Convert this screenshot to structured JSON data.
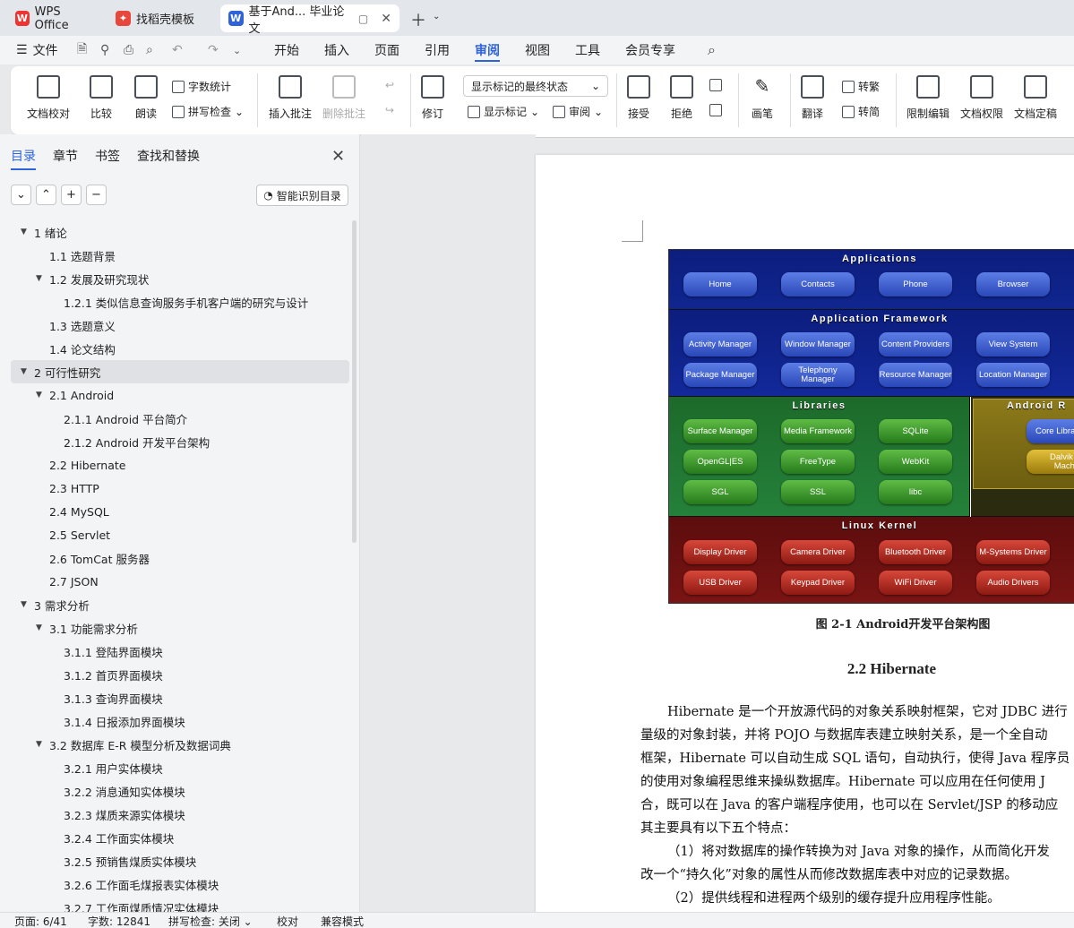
{
  "tabs": [
    {
      "label": "WPS Office"
    },
    {
      "label": "找稻壳模板"
    },
    {
      "label": "基于And... 毕业论文"
    }
  ],
  "menu": {
    "file": "文件",
    "items": [
      "开始",
      "插入",
      "页面",
      "引用",
      "审阅",
      "视图",
      "工具",
      "会员专享"
    ]
  },
  "ribbon": {
    "doc_proof": "文档校对",
    "compare": "比较",
    "read_aloud": "朗读",
    "word_count": "字数统计",
    "spell_check": "拼写检查",
    "insert_comment": "插入批注",
    "delete_comment": "删除批注",
    "track": "修订",
    "display_mode": "显示标记的最终状态",
    "show_markup": "显示标记",
    "review": "审阅",
    "accept": "接受",
    "reject": "拒绝",
    "pen": "画笔",
    "translate": "翻译",
    "to_trad": "转繁",
    "to_simp": "转简",
    "restrict": "限制编辑",
    "permissions": "文档权限",
    "finalize": "文档定稿"
  },
  "panel": {
    "tabs": [
      "目录",
      "章节",
      "书签",
      "查找和替换"
    ],
    "smart_toc": "智能识别目录",
    "toc": [
      {
        "t": "1  绪论",
        "lvl": 1
      },
      {
        "t": "1.1  选题背景",
        "lvl": 2
      },
      {
        "t": "1.2  发展及研究现状",
        "lvl": 2
      },
      {
        "t": "1.2.1 类似信息查询服务手机客户端的研究与设计",
        "lvl": 3
      },
      {
        "t": "1.3  选题意义",
        "lvl": 2
      },
      {
        "t": "1.4  论文结构",
        "lvl": 2
      },
      {
        "t": "2  可行性研究",
        "lvl": 1
      },
      {
        "t": "2.1 Android",
        "lvl": 2
      },
      {
        "t": "2.1.1 Android 平台简介",
        "lvl": 3
      },
      {
        "t": "2.1.2 Android 开发平台架构",
        "lvl": 3
      },
      {
        "t": "2.2 Hibernate",
        "lvl": 2
      },
      {
        "t": "2.3 HTTP",
        "lvl": 2
      },
      {
        "t": "2.4 MySQL",
        "lvl": 2
      },
      {
        "t": "2.5 Servlet",
        "lvl": 2
      },
      {
        "t": "2.6 TomCat 服务器",
        "lvl": 2
      },
      {
        "t": "2.7 JSON",
        "lvl": 2
      },
      {
        "t": "3  需求分析",
        "lvl": 1
      },
      {
        "t": "3.1  功能需求分析",
        "lvl": 2
      },
      {
        "t": "3.1.1  登陆界面模块",
        "lvl": 3
      },
      {
        "t": "3.1.2  首页界面模块",
        "lvl": 3
      },
      {
        "t": "3.1.3  查询界面模块",
        "lvl": 3
      },
      {
        "t": "3.1.4  日报添加界面模块",
        "lvl": 3
      },
      {
        "t": "3.2  数据库 E-R 模型分析及数据词典",
        "lvl": 2
      },
      {
        "t": "3.2.1  用户实体模块",
        "lvl": 3
      },
      {
        "t": "3.2.2  消息通知实体模块",
        "lvl": 3
      },
      {
        "t": "3.2.3  煤质来源实体模块",
        "lvl": 3
      },
      {
        "t": "3.2.4  工作面实体模块",
        "lvl": 3
      },
      {
        "t": "3.2.5  预销售煤质实体模块",
        "lvl": 3
      },
      {
        "t": "3.2.6  工作面毛煤报表实体模块",
        "lvl": 3
      },
      {
        "t": "3.2.7  工作面煤质情况实体模块",
        "lvl": 3
      }
    ]
  },
  "arch": {
    "applications": "Applications",
    "app_items": [
      "Home",
      "Contacts",
      "Phone",
      "Browser"
    ],
    "framework": "Application Framework",
    "fw_items": [
      "Activity Manager",
      "Window Manager",
      "Content Providers",
      "View System",
      "Package Manager",
      "Telephony Manager",
      "Resource Manager",
      "Location Manager"
    ],
    "libraries": "Libraries",
    "lib_items": [
      "Surface Manager",
      "Media Framework",
      "SQLite",
      "OpenGL|ES",
      "FreeType",
      "WebKit",
      "SGL",
      "SSL",
      "libc"
    ],
    "runtime": "Android R",
    "rt_items": [
      "Core Libra",
      "Dalvik Vir Machin"
    ],
    "kernel": "Linux Kernel",
    "kernel_items": [
      "Display Driver",
      "Camera Driver",
      "Bluetooth Driver",
      "M-Systems Driver",
      "USB Driver",
      "Keypad Driver",
      "WiFi Driver",
      "Audio Drivers"
    ]
  },
  "doc": {
    "caption": "图 2-1 Android开发平台架构图",
    "heading": "2.2 Hibernate",
    "lines": [
      "Hibernate 是一个开放源代码的对象关系映射框架，它对 JDBC 进行",
      "量级的对象封装，并将 POJO 与数据库表建立映射关系，是一个全自动",
      "框架，Hibernate 可以自动生成 SQL 语句，自动执行，使得 Java 程序员",
      "的使用对象编程思维来操纵数据库。Hibernate 可以应用在任何使用 J",
      "合，既可以在 Java 的客户端程序使用，也可以在 Servlet/JSP 的移动应",
      "其主要具有以下五个特点：",
      "（1）将对数据库的操作转换为对 Java 对象的操作，从而简化开发",
      "改一个“持久化”对象的属性从而修改数据库表中对应的记录数据。",
      "（2）提供线程和进程两个级别的缓存提升应用程序性能。"
    ]
  },
  "status": {
    "page": "页面: 6/41",
    "words": "字数: 12841",
    "spell": "拼写检查: 关闭",
    "proof": "校对",
    "compat": "兼容模式"
  }
}
